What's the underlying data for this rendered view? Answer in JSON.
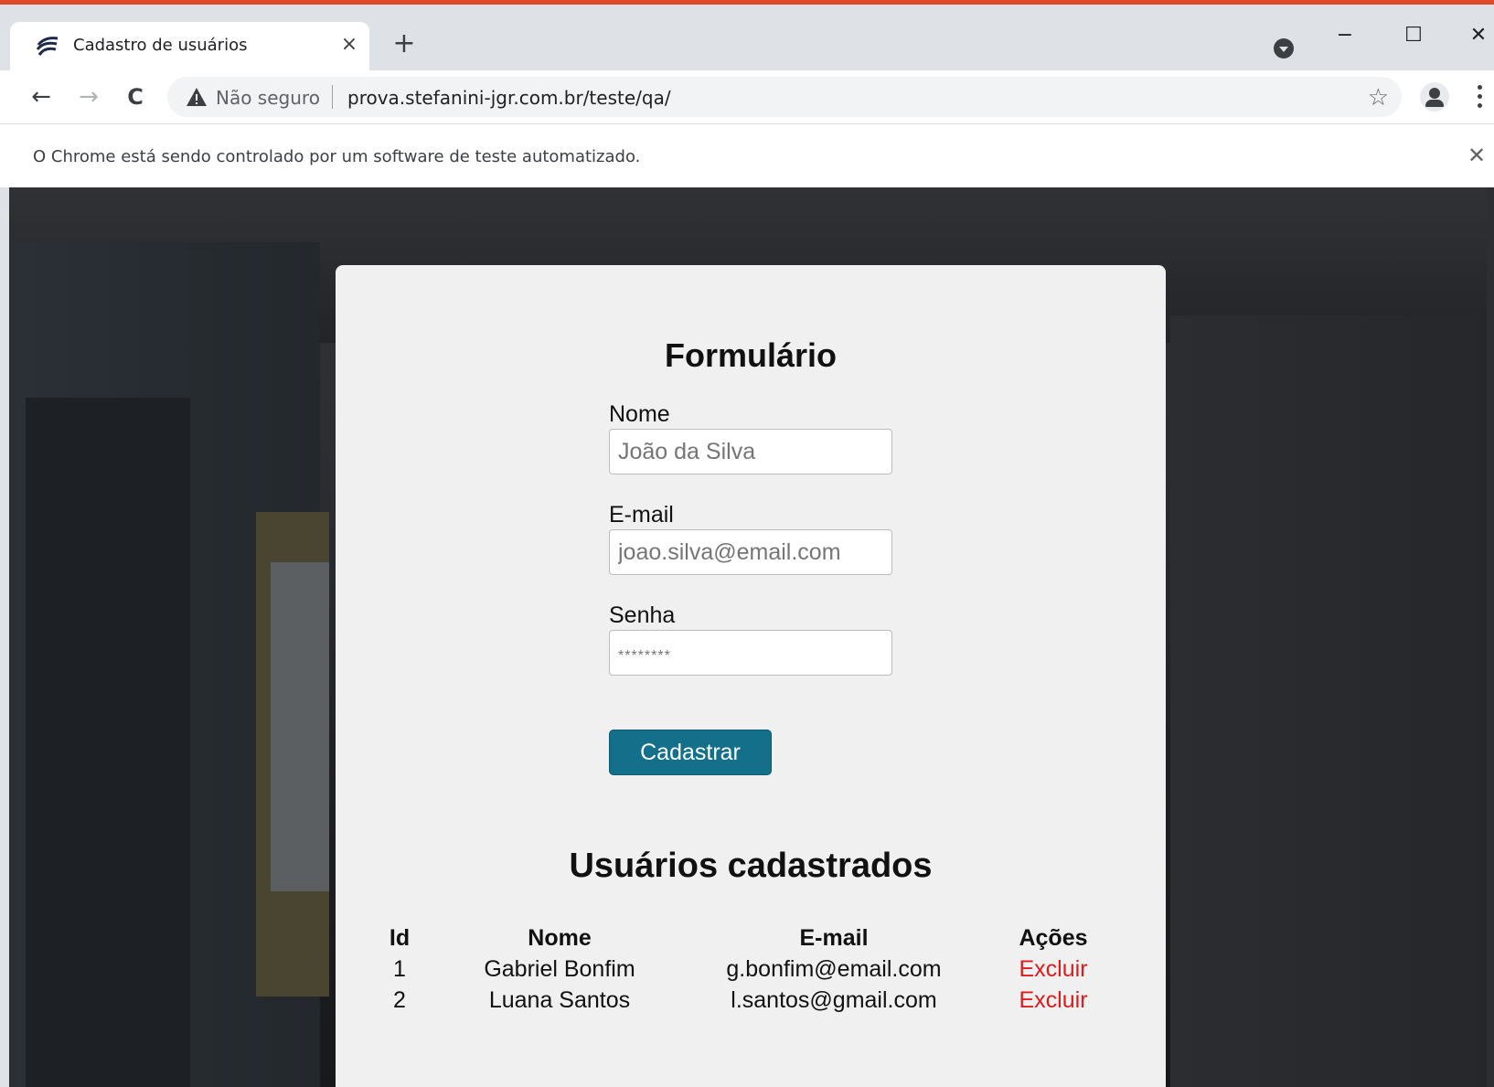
{
  "browser": {
    "tab_title": "Cadastro de usuários",
    "tab_close": "×",
    "new_tab": "+",
    "window_controls": {
      "minimize": "−",
      "maximize": "☐",
      "close": "✕"
    },
    "nav": {
      "back": "←",
      "forward": "→",
      "reload": "C"
    },
    "security_label": "Não seguro",
    "url": "prova.stefanini-jgr.com.br/teste/qa/",
    "bookmark": "☆",
    "infobar_text": "O Chrome está sendo controlado por um software de teste automatizado.",
    "infobar_close": "✕"
  },
  "form": {
    "title": "Formulário",
    "name": {
      "label": "Nome",
      "placeholder": "João da Silva"
    },
    "email": {
      "label": "E-mail",
      "placeholder": "joao.silva@email.com"
    },
    "password": {
      "label": "Senha",
      "placeholder": "********"
    },
    "submit_label": "Cadastrar"
  },
  "users": {
    "title": "Usuários cadastrados",
    "headers": {
      "id": "Id",
      "nome": "Nome",
      "email": "E-mail",
      "acoes": "Ações"
    },
    "rows": [
      {
        "id": "1",
        "nome": "Gabriel Bonfim",
        "email": "g.bonfim@email.com",
        "acao": "Excluir"
      },
      {
        "id": "2",
        "nome": "Luana Santos",
        "email": "l.santos@gmail.com",
        "acao": "Excluir"
      }
    ]
  },
  "colors": {
    "button": "#146f8a",
    "delete_link": "#e01b1b",
    "card": "#f0f0f0",
    "window_frame": "#dd4b2b"
  },
  "icons": {
    "favicon": "stefanini-logo-icon",
    "security": "warning-triangle-icon",
    "tab_search": "tab-search-icon",
    "profile": "profile-avatar-icon",
    "menu": "kebab-menu-icon"
  }
}
